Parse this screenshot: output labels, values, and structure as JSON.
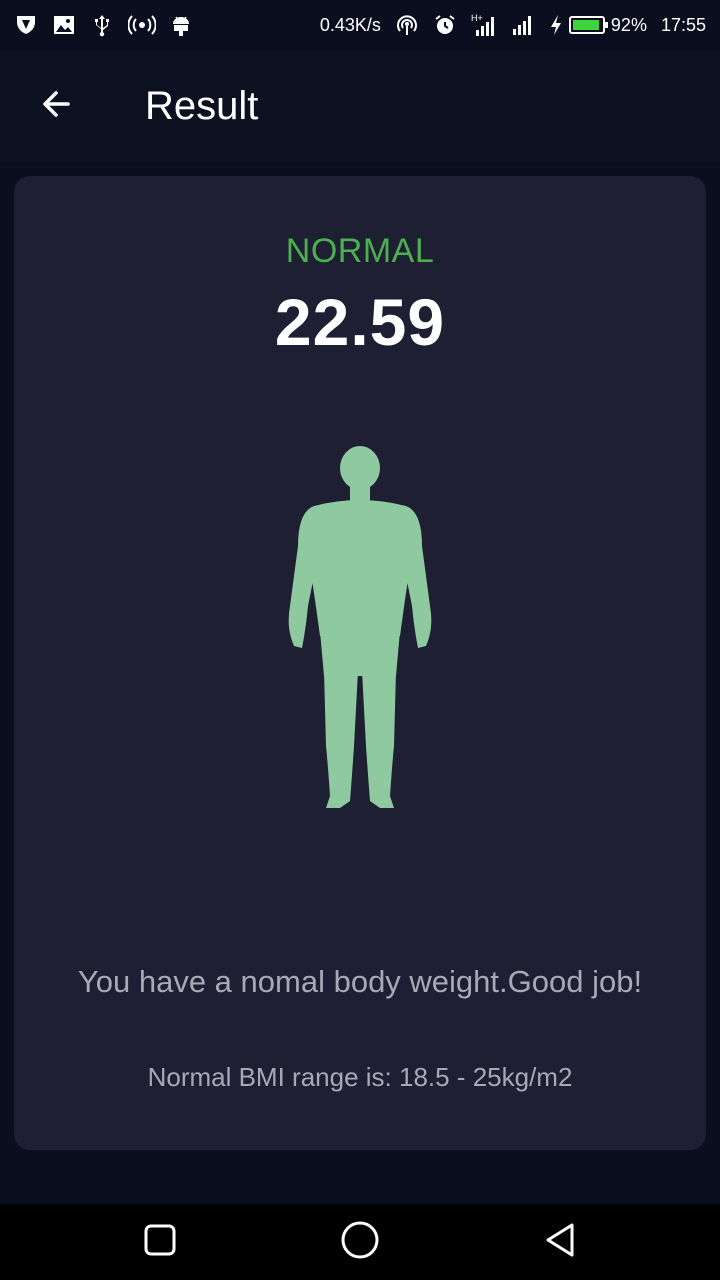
{
  "status_bar": {
    "net_speed": "0.43K/s",
    "battery_percent": "92%",
    "battery_level": 0.92,
    "time": "17:55",
    "icons_left": [
      "shield-app-icon",
      "image-icon",
      "usb-icon",
      "wireless-icon",
      "android-icon"
    ],
    "icons_right": [
      "hotspot-icon",
      "alarm-icon",
      "signal-h-icon",
      "signal-icon",
      "charging-icon",
      "battery-icon"
    ]
  },
  "app_bar": {
    "title": "Result"
  },
  "result": {
    "status_label": "NORMAL",
    "status_color": "#4caf50",
    "bmi_value": "22.59",
    "figure_color": "#8fc9a0",
    "message": "You have a nomal body weight.Good job!",
    "range_text": "Normal BMI range is:  18.5 - 25kg/m2"
  },
  "colors": {
    "background": "#0a0e1f",
    "card": "#1e1f33"
  }
}
